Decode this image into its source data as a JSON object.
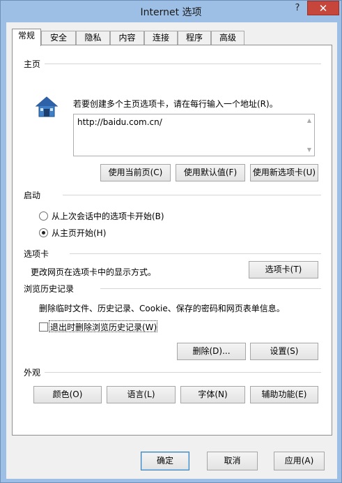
{
  "window": {
    "title": "Internet 选项",
    "help_label": "?",
    "close_label": "✕"
  },
  "tabs": [
    {
      "label": "常规"
    },
    {
      "label": "安全"
    },
    {
      "label": "隐私"
    },
    {
      "label": "内容"
    },
    {
      "label": "连接"
    },
    {
      "label": "程序"
    },
    {
      "label": "高级"
    }
  ],
  "homepage": {
    "heading": "主页",
    "description": "若要创建多个主页选项卡，请在每行输入一个地址(R)。",
    "value": "http://baidu.com.cn/",
    "btn_current": "使用当前页(C)",
    "btn_default": "使用默认值(F)",
    "btn_newtab": "使用新选项卡(U)"
  },
  "startup": {
    "heading": "启动",
    "option_last": "从上次会话中的选项卡开始(B)",
    "option_home": "从主页开始(H)",
    "selected": "home"
  },
  "tabs_section": {
    "heading": "选项卡",
    "description": "更改网页在选项卡中的显示方式。",
    "btn_tabs": "选项卡(T)"
  },
  "history": {
    "heading": "浏览历史记录",
    "description": "删除临时文件、历史记录、Cookie、保存的密码和网页表单信息。",
    "checkbox_label": "退出时删除浏览历史记录(W)",
    "checkbox_checked": false,
    "btn_delete": "删除(D)...",
    "btn_settings": "设置(S)"
  },
  "appearance": {
    "heading": "外观",
    "btn_colors": "颜色(O)",
    "btn_languages": "语言(L)",
    "btn_fonts": "字体(N)",
    "btn_accessibility": "辅助功能(E)"
  },
  "footer": {
    "btn_ok": "确定",
    "btn_cancel": "取消",
    "btn_apply": "应用(A)"
  }
}
